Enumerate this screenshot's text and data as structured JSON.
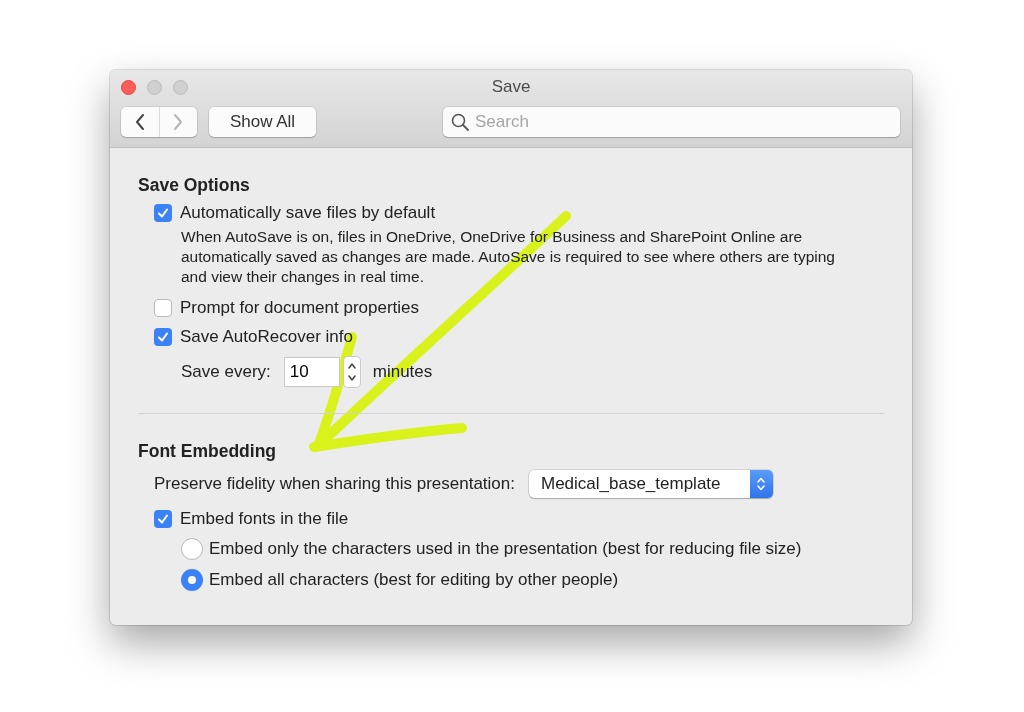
{
  "window": {
    "title": "Save"
  },
  "toolbar": {
    "back": {
      "disabled": false
    },
    "forward": {
      "disabled": true
    },
    "show_all_button": "Show All",
    "search": {
      "placeholder": "Search"
    }
  },
  "sections": [
    {
      "title": "Save Options",
      "items": [
        {
          "kind": "checkbox",
          "label": "Automatically save files by default",
          "checked": true,
          "description": "When AutoSave is on, files in OneDrive, OneDrive for Business and SharePoint Online are automatically saved as changes are made. AutoSave is required to see where others are typing and view their changes in real time."
        },
        {
          "kind": "checkbox",
          "label": "Prompt for document properties",
          "checked": false
        },
        {
          "kind": "checkbox",
          "label": "Save AutoRecover info",
          "checked": true
        },
        {
          "kind": "stepper",
          "label": "Save every:",
          "value": "10",
          "unit": "minutes"
        }
      ]
    },
    {
      "title": "Font Embedding",
      "items": [
        {
          "kind": "popup",
          "label": "Preserve fidelity when sharing this presentation:",
          "value": "Medical_base_template"
        },
        {
          "kind": "checkbox",
          "label": "Embed fonts in the file",
          "checked": true
        },
        {
          "kind": "radio",
          "label": "Embed only the characters used in the presentation (best for reducing file size)",
          "selected": false
        },
        {
          "kind": "radio",
          "label": "Embed all characters (best for editing by other people)",
          "selected": true
        }
      ]
    }
  ]
}
